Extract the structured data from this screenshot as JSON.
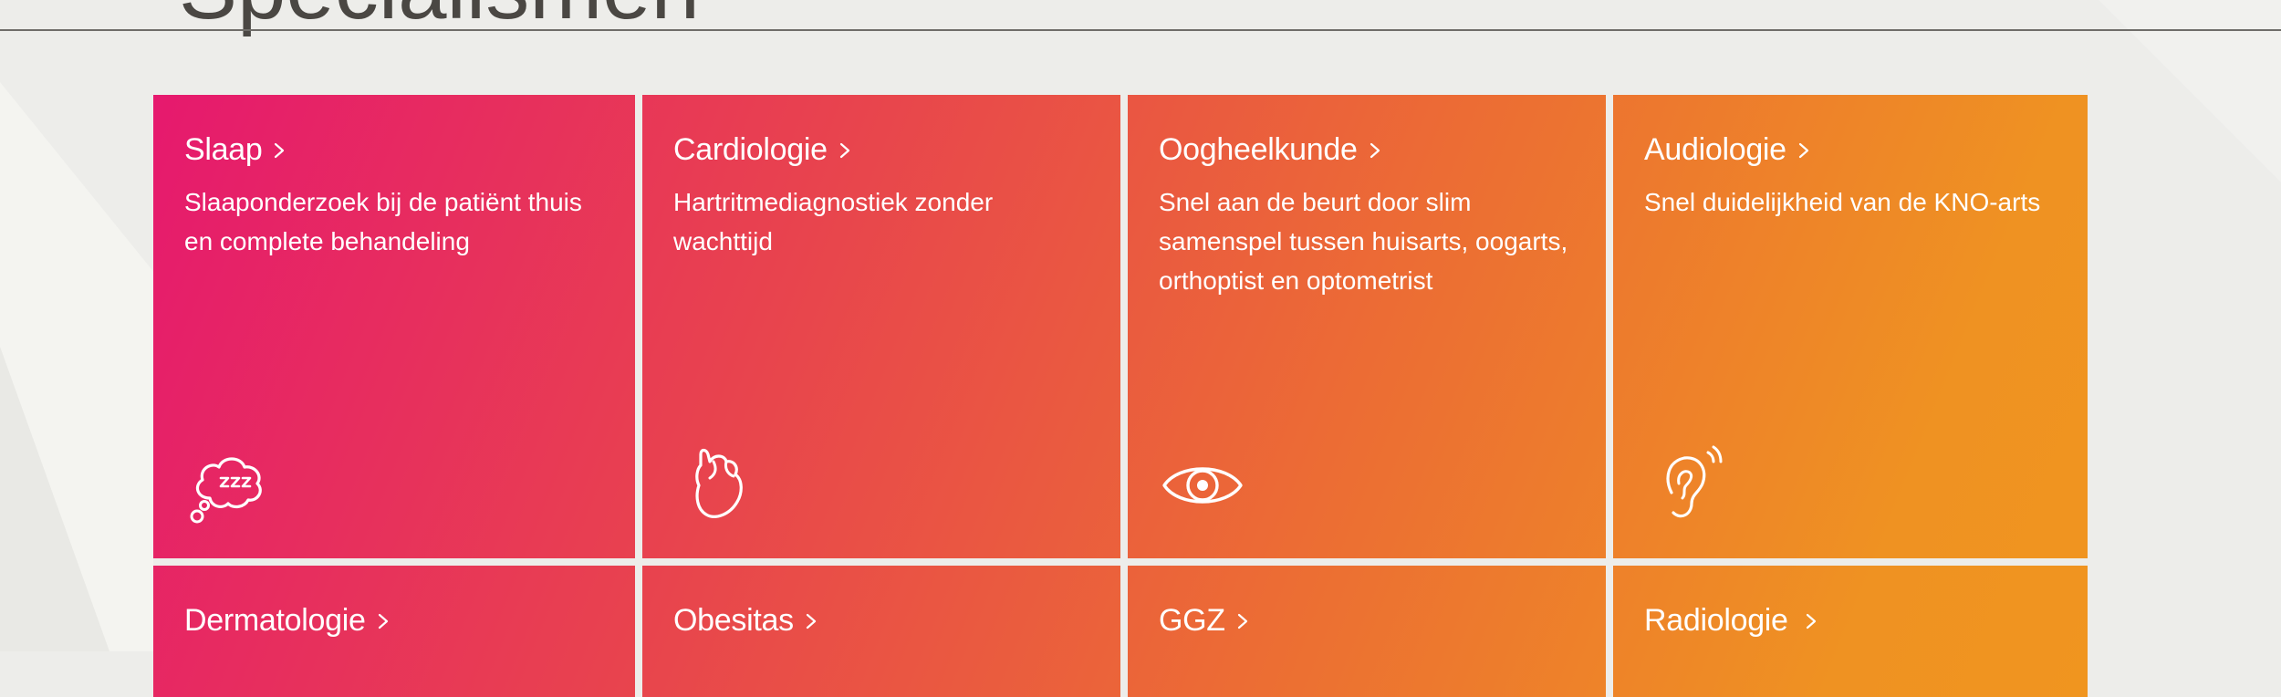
{
  "page": {
    "heading": "Specialismen"
  },
  "colors": {
    "background": "#ededea",
    "gradient_start": "#e6196e",
    "gradient_mid": "#ec6e33",
    "gradient_end": "#f0951f",
    "tile_text": "#ffffff",
    "heading_text": "#4a4743"
  },
  "tiles": [
    {
      "title": "Slaap",
      "description": "Slaaponderzoek bij de patiënt thuis en complete behandeling",
      "icon": "sleep-thought-bubble-icon"
    },
    {
      "title": "Cardiologie",
      "description": "Hartritmediagnostiek zonder wachttijd",
      "icon": "heart-icon"
    },
    {
      "title": "Oogheelkunde",
      "description": "Snel aan de beurt door slim samenspel tussen huisarts, oogarts, orthoptist en optometrist",
      "icon": "eye-icon"
    },
    {
      "title": "Audiologie",
      "description": "Snel duidelijkheid van de KNO-arts",
      "icon": "ear-icon"
    },
    {
      "title": "Dermatologie",
      "description": "",
      "icon": ""
    },
    {
      "title": "Obesitas",
      "description": "",
      "icon": ""
    },
    {
      "title": "GGZ",
      "description": "",
      "icon": ""
    },
    {
      "title": "Radiologie",
      "description": "",
      "icon": ""
    }
  ]
}
